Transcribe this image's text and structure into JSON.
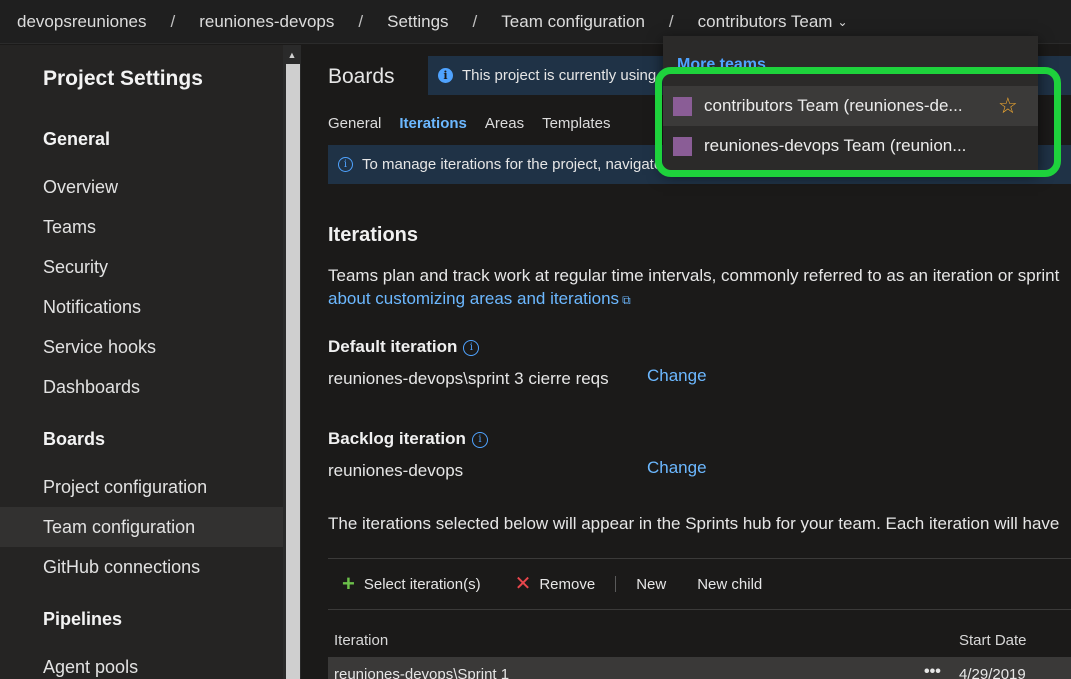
{
  "breadcrumb": {
    "items": [
      "devopsreuniones",
      "reuniones-devops",
      "Settings",
      "Team configuration",
      "contributors Team"
    ],
    "separator": "/"
  },
  "sidebar": {
    "title": "Project Settings",
    "sections": {
      "general": "General",
      "boards": "Boards",
      "pipelines": "Pipelines"
    },
    "items": {
      "overview": "Overview",
      "teams": "Teams",
      "security": "Security",
      "notifications": "Notifications",
      "service_hooks": "Service hooks",
      "dashboards": "Dashboards",
      "project_configuration": "Project configuration",
      "team_configuration": "Team configuration",
      "github_connections": "GitHub connections",
      "agent_pools": "Agent pools"
    },
    "selected": "Team configuration"
  },
  "main": {
    "title": "Boards",
    "banner_text": "This project is currently using",
    "tabs": [
      "General",
      "Iterations",
      "Areas",
      "Templates"
    ],
    "active_tab": "Iterations",
    "manage_banner": "To manage iterations for the project, navigate",
    "section_title": "Iterations",
    "description": "Teams plan and track work at regular time intervals, commonly referred to as an iteration or sprint",
    "description_link": "about customizing areas and iterations",
    "default_iteration": {
      "label": "Default iteration",
      "value": "reuniones-devops\\sprint 3 cierre reqs",
      "action": "Change"
    },
    "backlog_iteration": {
      "label": "Backlog iteration",
      "value": "reuniones-devops",
      "action": "Change"
    },
    "note": "The iterations selected below will appear in the Sprints hub for your team. Each iteration will have",
    "toolbar": {
      "select": "Select iteration(s)",
      "remove": "Remove",
      "new": "New",
      "new_child": "New child"
    },
    "table": {
      "columns": [
        "Iteration",
        "Start Date"
      ],
      "rows": [
        {
          "name": "reuniones-devops\\Sprint 1",
          "more": "•••",
          "start": "4/29/2019"
        }
      ]
    }
  },
  "team_dropdown": {
    "header": "More teams",
    "items": [
      {
        "label": "contributors Team (reuniones-de...",
        "favorite": true
      },
      {
        "label": "reuniones-devops Team (reunion..."
      }
    ]
  },
  "colors": {
    "accent": "#4fa3ff",
    "highlight": "#1ed23c",
    "team_swatch": "#8a5d96",
    "star": "#f0a830"
  }
}
